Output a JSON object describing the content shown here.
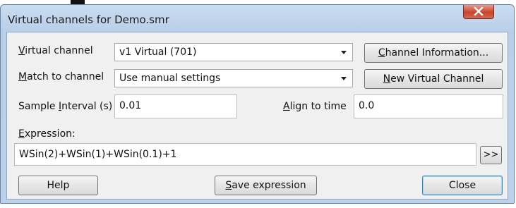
{
  "window": {
    "title": "Virtual channels for Demo.smr"
  },
  "virtual_channel": {
    "label_mnemonic": "V",
    "label_rest": "irtual channel",
    "value": "v1 Virtual (701)"
  },
  "match_channel": {
    "label_mnemonic": "M",
    "label_rest": "atch to channel",
    "value": "Use manual settings"
  },
  "buttons": {
    "channel_info": {
      "mnemonic": "C",
      "rest": "hannel Information..."
    },
    "new_virtual": {
      "mnemonic": "N",
      "rest": "ew Virtual Channel"
    },
    "insert": ">>",
    "help": "Help",
    "save_expression": {
      "mnemonic": "S",
      "rest": "ave expression"
    },
    "close": "Close"
  },
  "sample_interval": {
    "label_before": "Sample ",
    "label_mnemonic": "I",
    "label_after": "nterval (s)",
    "value": "0.01"
  },
  "align_time": {
    "label_mnemonic": "A",
    "label_rest": "lign to time",
    "value": "0.0"
  },
  "expression": {
    "label_mnemonic": "E",
    "label_rest": "xpression:",
    "value": "WSin(2)+WSin(1)+WSin(0.1)+1"
  }
}
